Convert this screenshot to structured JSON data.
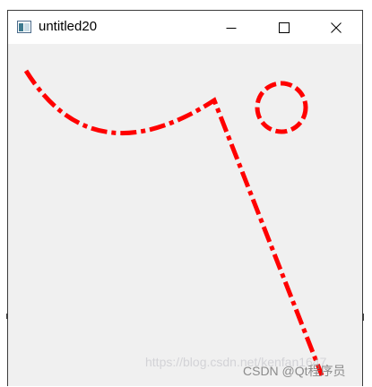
{
  "window": {
    "title": "untitled20",
    "controls": {
      "minimize_icon": "minimize-icon",
      "maximize_icon": "maximize-icon",
      "close_icon": "close-icon"
    }
  },
  "drawing": {
    "stroke_color": "#ff0000",
    "line_style": "dash-dot"
  },
  "watermark": {
    "url_text": "https://blog.csdn.net/kenfan1647",
    "brand_text": "CSDN @Qt程序员"
  }
}
